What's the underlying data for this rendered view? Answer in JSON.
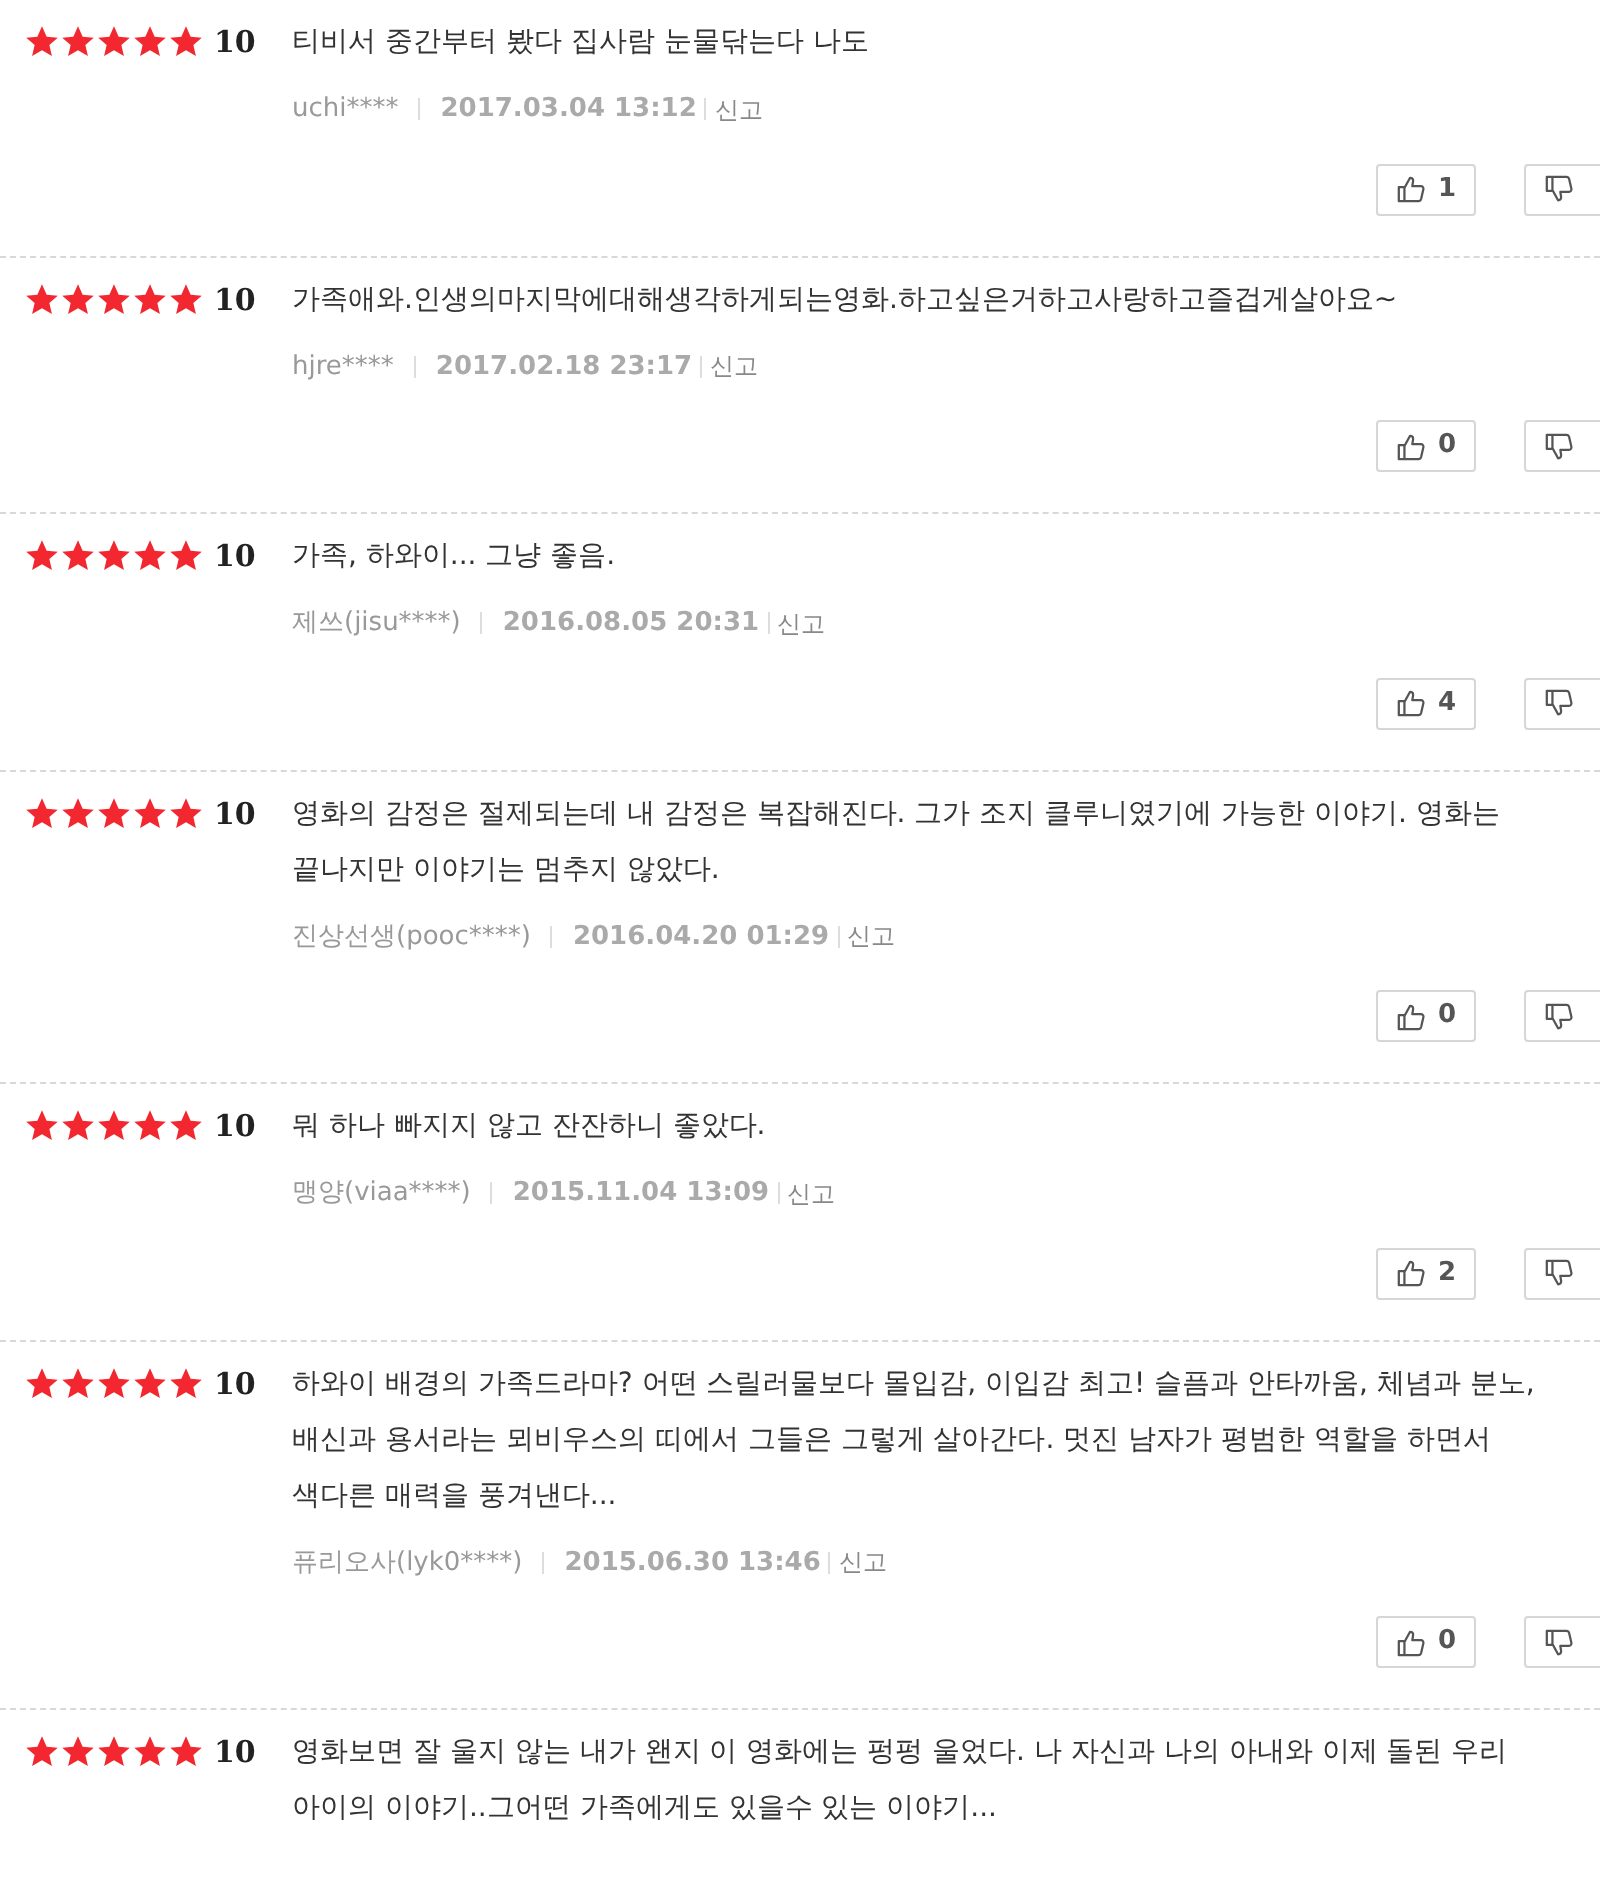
{
  "reviews": [
    {
      "stars": 5,
      "score": "10",
      "text": "티비서 중간부터 봤다 집사람 눈물닦는다 나도",
      "user": "uchi****",
      "date": "2017.03.04 13:12",
      "report": "신고",
      "likes": "1"
    },
    {
      "stars": 5,
      "score": "10",
      "text": "가족애와.인생의마지막에대해생각하게되는영화.하고싶은거하고사랑하고즐겁게살아요~",
      "user": "hjre****",
      "date": "2017.02.18 23:17",
      "report": "신고",
      "likes": "0"
    },
    {
      "stars": 5,
      "score": "10",
      "text": "가족, 하와이... 그냥 좋음.",
      "user": "제쓰(jisu****)",
      "date": "2016.08.05 20:31",
      "report": "신고",
      "likes": "4"
    },
    {
      "stars": 5,
      "score": "10",
      "text": "영화의 감정은 절제되는데 내 감정은 복잡해진다. 그가 조지 클루니였기에 가능한 이야기. 영화는 끝나지만 이야기는 멈추지 않았다.",
      "user": "진상선생(pooc****)",
      "date": "2016.04.20 01:29",
      "report": "신고",
      "likes": "0"
    },
    {
      "stars": 5,
      "score": "10",
      "text": "뭐 하나 빠지지 않고 잔잔하니 좋았다.",
      "user": "맹양(viaa****)",
      "date": "2015.11.04 13:09",
      "report": "신고",
      "likes": "2"
    },
    {
      "stars": 5,
      "score": "10",
      "text": "하와이 배경의 가족드라마? 어떤 스릴러물보다 몰입감, 이입감 최고! 슬픔과 안타까움, 체념과 분노, 배신과 용서라는 뫼비우스의 띠에서 그들은 그렇게 살아간다. 멋진 남자가 평범한 역할을 하면서 색다른 매력을 풍겨낸다...",
      "user": "퓨리오사(lyk0****)",
      "date": "2015.06.30 13:46",
      "report": "신고",
      "likes": "0"
    },
    {
      "stars": 5,
      "score": "10",
      "text": "영화보면 잘 울지 않는 내가 왠지 이 영화에는 펑펑 울었다. 나 자신과 나의 아내와 이제 돌된 우리 아이의 이야기..그어떤 가족에게도 있을수 있는 이야기..."
    }
  ]
}
